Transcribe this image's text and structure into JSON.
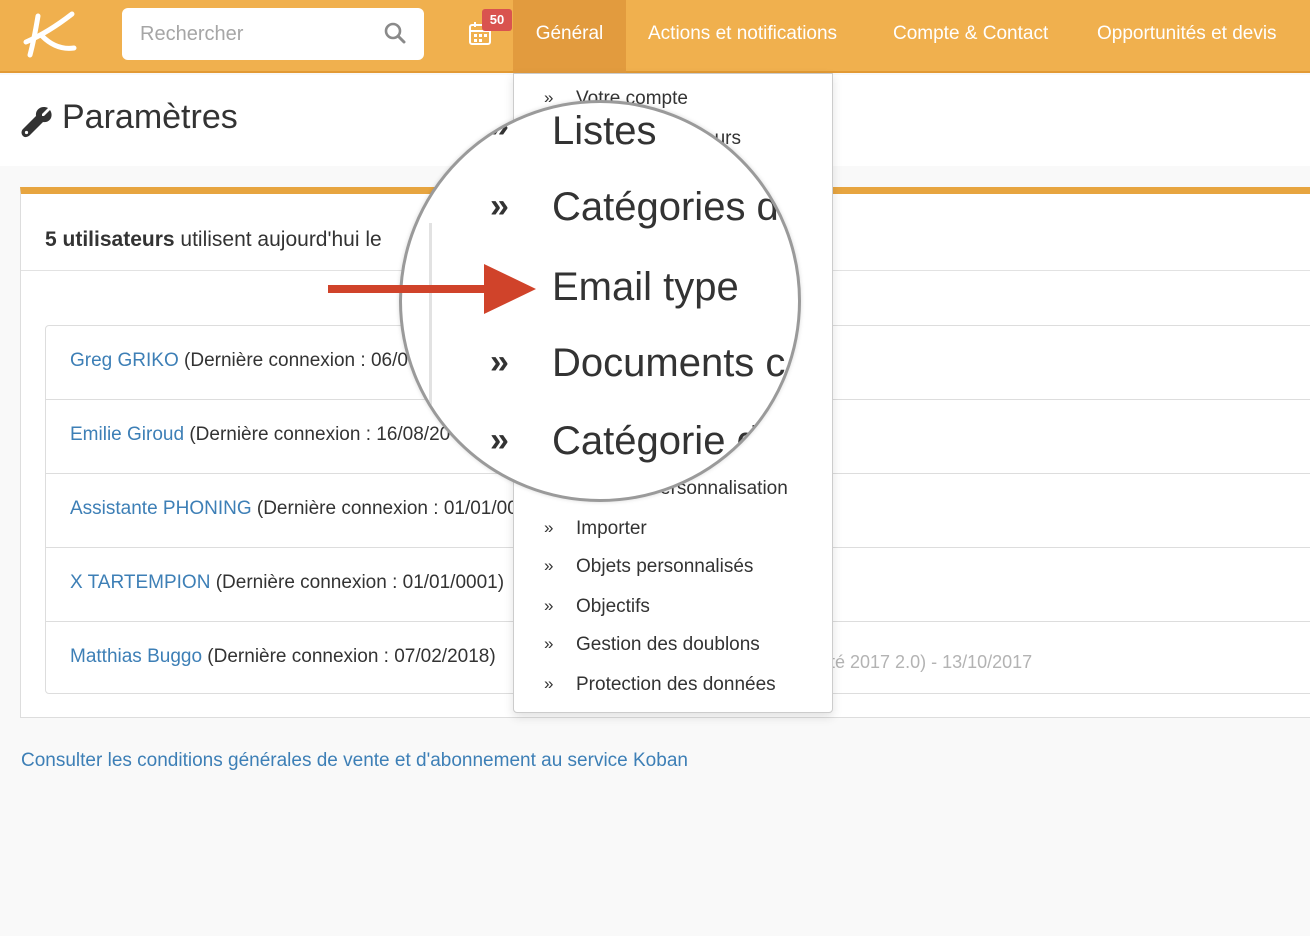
{
  "nav": {
    "search_placeholder": "Rechercher",
    "badge_count": "50",
    "items": [
      "Général",
      "Actions et notifications",
      "Compte & Contact",
      "Opportunités et devis"
    ]
  },
  "page": {
    "title": "Paramètres"
  },
  "panel": {
    "header_bold": "5 utilisateurs",
    "header_rest": " utilisent aujourd'hui le",
    "users": [
      {
        "name": "Greg GRIKO",
        "info": " (Dernière connexion : 06/06"
      },
      {
        "name": "Emilie Giroud",
        "info": " (Dernière connexion : 16/08/20"
      },
      {
        "name": "Assistante PHONING",
        "info": " (Dernière connexion : 01/01/00"
      },
      {
        "name": "X TARTEMPION",
        "info": " (Dernière connexion : 01/01/0001)"
      },
      {
        "name": "Matthias Buggo",
        "info": " (Dernière connexion : 07/02/2018)"
      }
    ],
    "version": "(Eté 2017 2.0) - 13/10/2017"
  },
  "terms_link": "Consulter les conditions générales de vente et d'abonnement au service Koban",
  "dropdown": {
    "chevron": "»",
    "items": [
      "Votre compte",
      "eurs",
      "ersonnalisation",
      "Importer",
      "Objets personnalisés",
      "Objectifs",
      "Gestion des doublons",
      "Protection des données"
    ]
  },
  "magnifier": {
    "items": [
      "Listes",
      "Catégories d",
      "Email type",
      "Documents c",
      "Catégorie d"
    ]
  },
  "colors": {
    "nav_bg": "#f0b04e",
    "accent": "#e7a540",
    "link": "#3d7fb6",
    "badge": "#d9534f",
    "arrow": "#d0432a"
  }
}
